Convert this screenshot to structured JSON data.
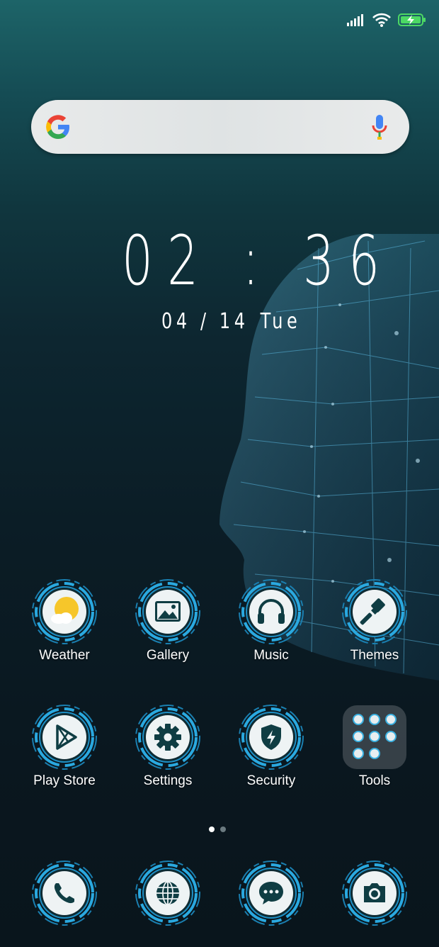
{
  "status_bar": {
    "icons": [
      "signal-icon",
      "wifi-icon",
      "battery-charging-icon"
    ]
  },
  "search_bar": {
    "icons": [
      "google-logo-icon",
      "microphone-icon"
    ]
  },
  "clock": {
    "time": "02 : 36",
    "date": "04 / 14",
    "day": "Tue"
  },
  "apps_row1": [
    {
      "label": "Weather",
      "icon": "weather-icon"
    },
    {
      "label": "Gallery",
      "icon": "gallery-icon"
    },
    {
      "label": "Music",
      "icon": "headphones-icon"
    },
    {
      "label": "Themes",
      "icon": "paintbrush-icon"
    }
  ],
  "apps_row2": [
    {
      "label": "Play Store",
      "icon": "play-store-icon"
    },
    {
      "label": "Settings",
      "icon": "gear-icon"
    },
    {
      "label": "Security",
      "icon": "shield-icon"
    },
    {
      "label": "Tools",
      "icon": "folder-icon"
    }
  ],
  "page_indicator": {
    "pages": 2,
    "current": 1
  },
  "dock": [
    {
      "icon": "phone-icon"
    },
    {
      "icon": "browser-globe-icon"
    },
    {
      "icon": "messages-icon"
    },
    {
      "icon": "camera-icon"
    }
  ],
  "colors": {
    "ring_accent": "#2aa9e0",
    "icon_glyph": "#0f3d43",
    "weather_sun": "#f6c62a",
    "battery": "#4cd964"
  }
}
